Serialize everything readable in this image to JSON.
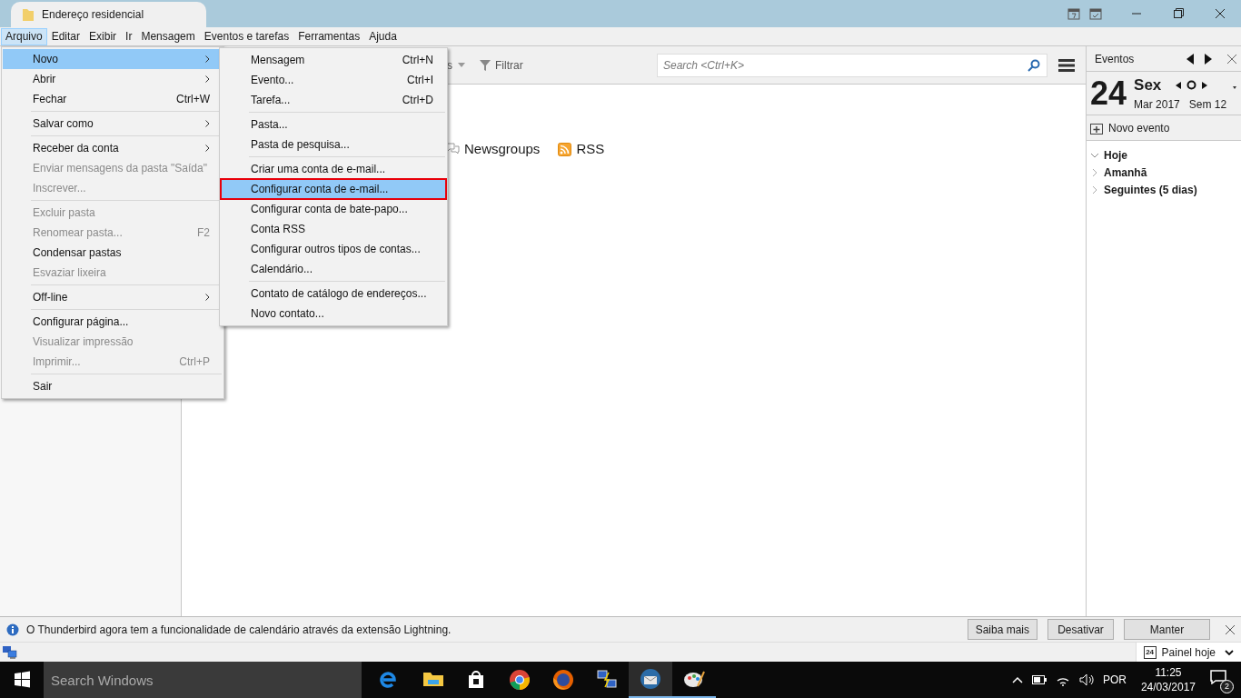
{
  "window": {
    "title": "Endereço residencial"
  },
  "menubar": [
    {
      "label": "Arquivo",
      "selected": true
    },
    {
      "label": "Editar",
      "selected": false
    },
    {
      "label": "Exibir",
      "selected": false
    },
    {
      "label": "Ir",
      "selected": false
    },
    {
      "label": "Mensagem",
      "selected": false
    },
    {
      "label": "Eventos e tarefas",
      "selected": false
    },
    {
      "label": "Ferramentas",
      "selected": false
    },
    {
      "label": "Ajuda",
      "selected": false
    }
  ],
  "file_menu": {
    "items": [
      {
        "kind": "item",
        "label": "Novo",
        "submenu": true,
        "disabled": false,
        "selected": true
      },
      {
        "kind": "item",
        "label": "Abrir",
        "submenu": true,
        "disabled": false,
        "selected": false
      },
      {
        "kind": "item",
        "label": "Fechar",
        "shortcut": "Ctrl+W",
        "disabled": false,
        "selected": false
      },
      {
        "kind": "separator"
      },
      {
        "kind": "item",
        "label": "Salvar como",
        "submenu": true,
        "disabled": false,
        "selected": false
      },
      {
        "kind": "separator"
      },
      {
        "kind": "item",
        "label": "Receber da conta",
        "submenu": true,
        "disabled": false,
        "selected": false
      },
      {
        "kind": "item",
        "label": "Enviar mensagens da pasta \"Saída\"",
        "disabled": true,
        "selected": false
      },
      {
        "kind": "item",
        "label": "Inscrever...",
        "disabled": true,
        "selected": false
      },
      {
        "kind": "separator"
      },
      {
        "kind": "item",
        "label": "Excluir pasta",
        "disabled": true,
        "selected": false
      },
      {
        "kind": "item",
        "label": "Renomear pasta...",
        "shortcut": "F2",
        "disabled": true,
        "selected": false
      },
      {
        "kind": "item",
        "label": "Condensar pastas",
        "disabled": false,
        "selected": false
      },
      {
        "kind": "item",
        "label": "Esvaziar lixeira",
        "disabled": true,
        "selected": false
      },
      {
        "kind": "separator"
      },
      {
        "kind": "item",
        "label": "Off-line",
        "submenu": true,
        "disabled": false,
        "selected": false
      },
      {
        "kind": "separator"
      },
      {
        "kind": "item",
        "label": "Configurar página...",
        "disabled": false,
        "selected": false
      },
      {
        "kind": "item",
        "label": "Visualizar impressão",
        "disabled": true,
        "selected": false
      },
      {
        "kind": "item",
        "label": "Imprimir...",
        "shortcut": "Ctrl+P",
        "disabled": true,
        "selected": false
      },
      {
        "kind": "separator"
      },
      {
        "kind": "item",
        "label": "Sair",
        "disabled": false,
        "selected": false
      }
    ]
  },
  "new_submenu": {
    "items": [
      {
        "kind": "item",
        "label": "Mensagem",
        "shortcut": "Ctrl+N",
        "selected": false,
        "outlined": false
      },
      {
        "kind": "item",
        "label": "Evento...",
        "shortcut": "Ctrl+I",
        "selected": false,
        "outlined": false
      },
      {
        "kind": "item",
        "label": "Tarefa...",
        "shortcut": "Ctrl+D",
        "selected": false,
        "outlined": false
      },
      {
        "kind": "separator"
      },
      {
        "kind": "item",
        "label": "Pasta...",
        "selected": false,
        "outlined": false
      },
      {
        "kind": "item",
        "label": "Pasta de pesquisa...",
        "selected": false,
        "outlined": false
      },
      {
        "kind": "separator"
      },
      {
        "kind": "item",
        "label": "Criar uma conta de e-mail...",
        "selected": false,
        "outlined": false
      },
      {
        "kind": "item",
        "label": "Configurar conta de e-mail...",
        "selected": true,
        "outlined": true
      },
      {
        "kind": "item",
        "label": "Configurar conta de bate-papo...",
        "selected": false,
        "outlined": false
      },
      {
        "kind": "item",
        "label": "Conta RSS",
        "selected": false,
        "outlined": false
      },
      {
        "kind": "item",
        "label": "Configurar outros tipos de contas...",
        "selected": false,
        "outlined": false
      },
      {
        "kind": "item",
        "label": "Calendário...",
        "selected": false,
        "outlined": false
      },
      {
        "kind": "separator"
      },
      {
        "kind": "item",
        "label": "Contato de catálogo de endereços...",
        "selected": false,
        "outlined": false
      },
      {
        "kind": "item",
        "label": "Novo contato...",
        "selected": false,
        "outlined": false
      }
    ]
  },
  "toolbar": {
    "partial_button": "s",
    "filter": "Filtrar",
    "search": {
      "placeholder": "Search <Ctrl+K>"
    }
  },
  "content": {
    "account_types": [
      {
        "kind": "newsgroups",
        "label": "Newsgroups"
      },
      {
        "kind": "rss",
        "label": "RSS"
      }
    ]
  },
  "events_pane": {
    "title": "Eventos",
    "day": "24",
    "weekday": "Sex",
    "month": "Mar 2017",
    "week": "Sem 12",
    "new_event": "Novo evento",
    "groups": [
      {
        "label": "Hoje",
        "expanded": true
      },
      {
        "label": "Amanhã",
        "expanded": false
      },
      {
        "label": "Seguintes (5 dias)",
        "expanded": false
      }
    ]
  },
  "notification": {
    "text": "O Thunderbird agora tem a funcionalidade de calendário através da extensão Lightning.",
    "buttons": [
      "Saiba mais",
      "Desativar",
      "Manter"
    ]
  },
  "status_bar": {
    "today_icon_day": "24",
    "today_pane": "Painel hoje"
  },
  "taskbar": {
    "search": {
      "placeholder": "Search Windows"
    },
    "language": "POR",
    "time": "11:25",
    "date": "24/03/2017",
    "notifications": "2"
  }
}
